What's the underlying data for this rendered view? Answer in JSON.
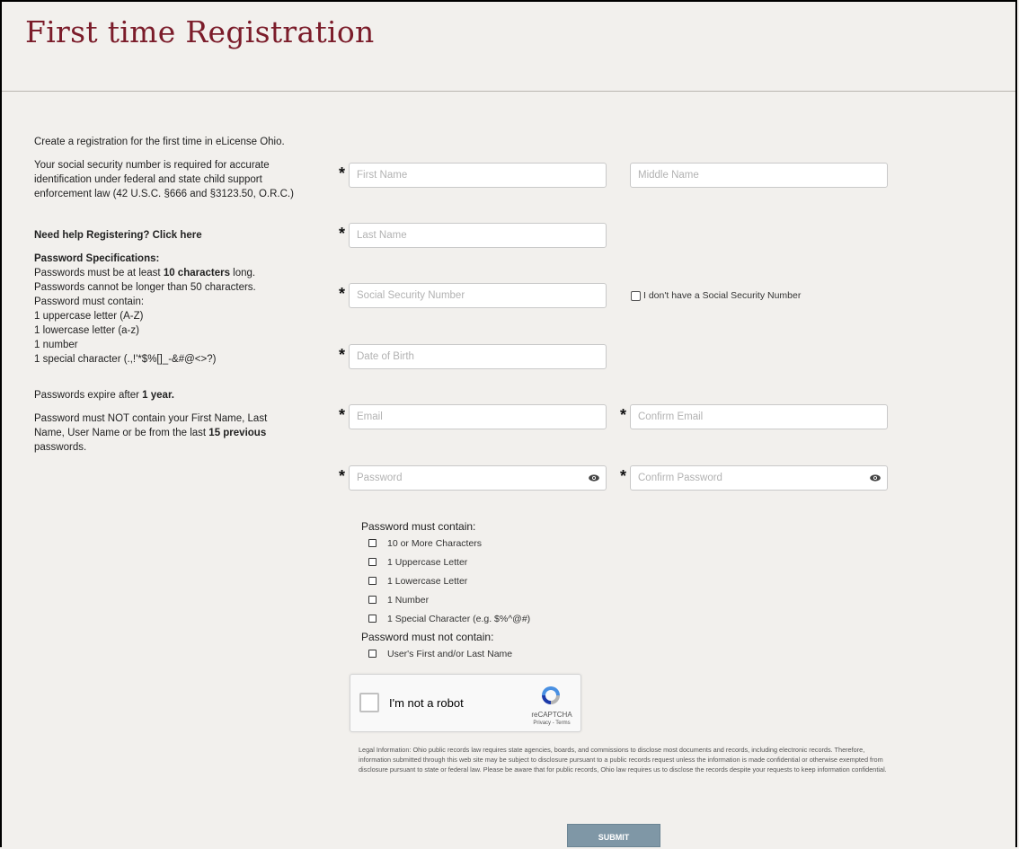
{
  "title": "First time Registration",
  "info": {
    "intro": "Create a registration for the first time in eLicense Ohio.",
    "ssn_notice": "Your social security number is required for accurate identification under federal and state child support enforcement law (42 U.S.C. §666 and §3123.50, O.R.C.)",
    "help_link": "Need help Registering? Click here",
    "pw_spec_head": "Password Specifications:",
    "pw_min_a": "Passwords must be at least ",
    "pw_min_b": "10 characters",
    "pw_min_c": " long.",
    "pw_max": "Passwords cannot be longer than 50 characters.",
    "pw_contain": "Password must contain:",
    "pw_upper": "1 uppercase letter (A-Z)",
    "pw_lower": "1 lowercase letter (a-z)",
    "pw_number": "1 number",
    "pw_special": "1 special character (.,!'*$%[]_-&#@<>?)",
    "expire_a": "Passwords expire after ",
    "expire_b": "1 year.",
    "not_contain_a": "Password must NOT contain your First Name, Last Name, User Name or be from the last ",
    "not_contain_b": "15 previous",
    "not_contain_c": " passwords."
  },
  "form": {
    "required_mark": "*",
    "first_name": "First Name",
    "middle_name": "Middle Name",
    "last_name": "Last Name",
    "ssn": "Social Security Number",
    "no_ssn": "I don't have a Social Security Number",
    "dob": "Date of Birth",
    "email": "Email",
    "confirm_email": "Confirm Email",
    "password": "Password",
    "confirm_password": "Confirm Password"
  },
  "pw_rules": {
    "must_head": "Password must contain:",
    "must": [
      "10 or More Characters",
      "1 Uppercase Letter",
      "1 Lowercase Letter",
      "1 Number",
      "1 Special Character (e.g. $%^@#)"
    ],
    "must_not_head": "Password must not contain:",
    "must_not": [
      "User's First and/or Last Name"
    ]
  },
  "captcha": {
    "label": "I'm not a robot",
    "brand": "reCAPTCHA",
    "links": "Privacy - Terms"
  },
  "legal": "Legal Information: Ohio public records law requires state agencies, boards, and commissions to disclose most documents and records, including electronic records. Therefore, information submitted through this web site may be subject to disclosure pursuant to a public records request unless the information is made confidential or otherwise exempted from disclosure pursuant to state or federal law. Please be aware that for public records, Ohio law requires us to disclose the records despite your requests to keep information confidential.",
  "submit": "SUBMIT",
  "colors": {
    "title": "#7b1c2a",
    "background": "#f2f0ed",
    "submit": "#7f97a6"
  }
}
